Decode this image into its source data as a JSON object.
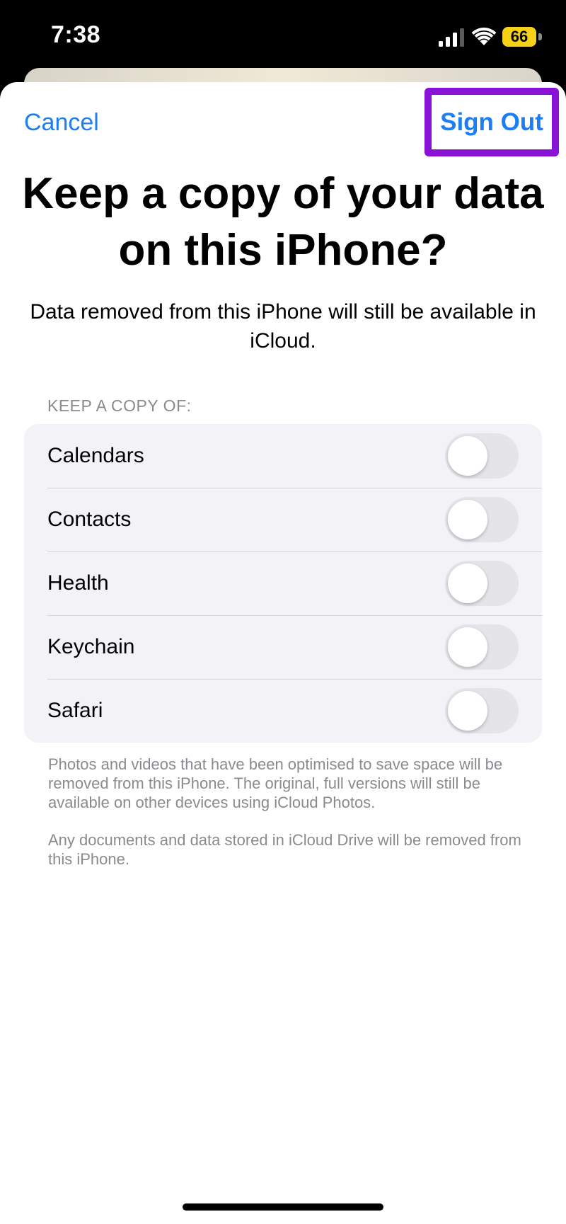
{
  "status_bar": {
    "time": "7:38",
    "battery_level": "66",
    "icons": [
      "signal-icon",
      "wifi-icon",
      "battery-icon"
    ]
  },
  "nav": {
    "cancel_label": "Cancel",
    "sign_out_label": "Sign Out"
  },
  "header": {
    "title": "Keep a copy of your data on this iPhone?",
    "subtitle": "Data removed from this iPhone will still be available in iCloud."
  },
  "keep_copy": {
    "section_label": "KEEP A COPY OF:",
    "items": [
      {
        "label": "Calendars",
        "enabled": false
      },
      {
        "label": "Contacts",
        "enabled": false
      },
      {
        "label": "Health",
        "enabled": false
      },
      {
        "label": "Keychain",
        "enabled": false
      },
      {
        "label": "Safari",
        "enabled": false
      }
    ]
  },
  "footer": {
    "note_photos": "Photos and videos that have been optimised to save space will be removed from this iPhone. The original, full versions will still be available on other devices using iCloud Photos.",
    "note_documents": "Any documents and data stored in iCloud Drive will be removed from this iPhone."
  },
  "colors": {
    "accent": "#1d7ef3",
    "highlight": "#8a12d6",
    "battery": "#f7d117"
  }
}
